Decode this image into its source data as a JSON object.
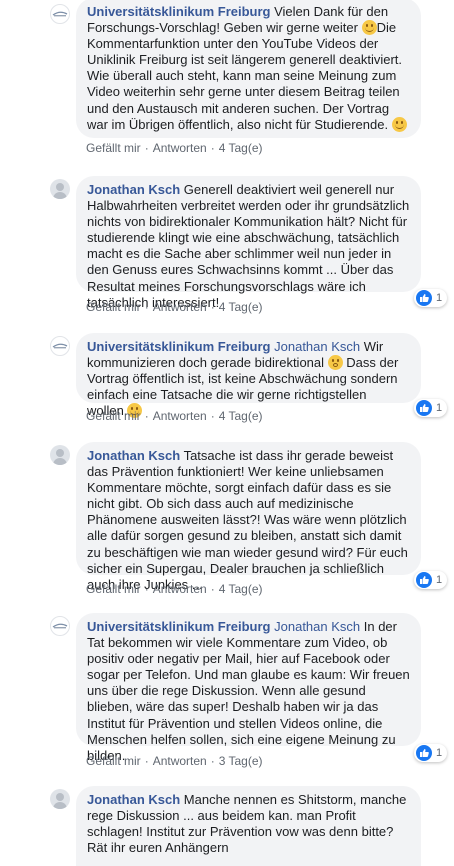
{
  "comments": [
    {
      "author": "Universitätsklinikum Freiburg",
      "text_1": " Vielen Dank für den Forschungs-Vorschlag! Geben wir gerne weiter ",
      "text_2": "Die Kommentarfunktion unter den YouTube Videos der Uniklinik Freiburg ist seit längerem generell deaktiviert. Wie überall auch steht, kann man seine Meinung zum Video weiterhin sehr gerne unter diesem Beitrag teilen und den Austausch mit anderen suchen. Der Vortrag war im Übrigen öffentlich, also nicht für Studierende. ",
      "like": "Gefällt mir",
      "reply": "Antworten",
      "time": "4 Tag(e)"
    },
    {
      "author": "Jonathan Ksch",
      "text_1": " Generell deaktiviert weil generell nur Halbwahrheiten verbreitet werden oder ihr grundsätzlich nichts von bidirektionaler Kommunikation hält? Nicht für studierende klingt wie eine abschwächung, tatsächlich macht es die Sache aber schlimmer weil nun jeder in den Genuss eures Schwachsinns kommt ... Über das Resultat meines Forschungsvorschlags wäre ich tatsächlich interessiert!",
      "like": "Gefällt mir",
      "reply": "Antworten",
      "time": "4 Tag(e)",
      "reactions": "1"
    },
    {
      "author": "Universitätsklinikum Freiburg",
      "mention": "Jonathan Ksch",
      "text_1": " Wir kommunizieren doch gerade bidirektional ",
      "text_2": " Dass der Vortrag öffentlich ist, ist keine Abschwächung sondern einfach eine Tatsache die wir gerne richtigstellen wollen.",
      "like": "Gefällt mir",
      "reply": "Antworten",
      "time": "4 Tag(e)",
      "reactions": "1"
    },
    {
      "author": "Jonathan Ksch",
      "text_1": " Tatsache ist dass ihr gerade beweist das Prävention funktioniert! Wer keine unliebsamen Kommentare möchte, sorgt einfach dafür dass es sie nicht gibt. Ob sich dass auch auf medizinische Phänomene ausweiten lässt?! Was wäre wenn plötzlich alle dafür sorgen gesund zu bleiben, anstatt sich damit zu beschäftigen wie man wieder gesund wird? Für euch sicher ein Supergau, Dealer brauchen ja schließlich auch ihre Junkies ...",
      "like": "Gefällt mir",
      "reply": "Antworten",
      "time": "4 Tag(e)",
      "reactions": "1"
    },
    {
      "author": "Universitätsklinikum Freiburg",
      "mention": "Jonathan Ksch",
      "text_1": " In der Tat bekommen wir viele Kommentare zum Video, ob positiv oder negativ per Mail, hier auf Facebook oder sogar per Telefon. Und man glaube es kaum: Wir freuen uns über die rege Diskussion. Wenn alle gesund blieben, wäre das super! Deshalb haben wir ja das Institut für Prävention und stellen Videos online, die Menschen helfen sollen, sich eine eigene Meinung zu bilden.",
      "like": "Gefällt mir",
      "reply": "Antworten",
      "time": "3 Tag(e)",
      "reactions": "1"
    },
    {
      "author": "Jonathan Ksch",
      "text_1": " Manche nennen es Shitstorm, manche rege Diskussion ... aus beidem kan. man Profit schlagen! Institut zur Prävention vow was denn bitte? Rät ihr euren Anhängern"
    }
  ],
  "colors": {
    "author": "#385898",
    "bubble": "#f2f3f5",
    "meta": "#606770",
    "like_badge": "#1877f2"
  },
  "icons": {
    "uni_avatar": "university-logo-icon",
    "person_avatar": "default-person-icon",
    "like_badge": "thumbs-up-icon",
    "smile_emoji": "smile-emoji-icon",
    "surprised_emoji": "surprised-emoji-icon"
  }
}
